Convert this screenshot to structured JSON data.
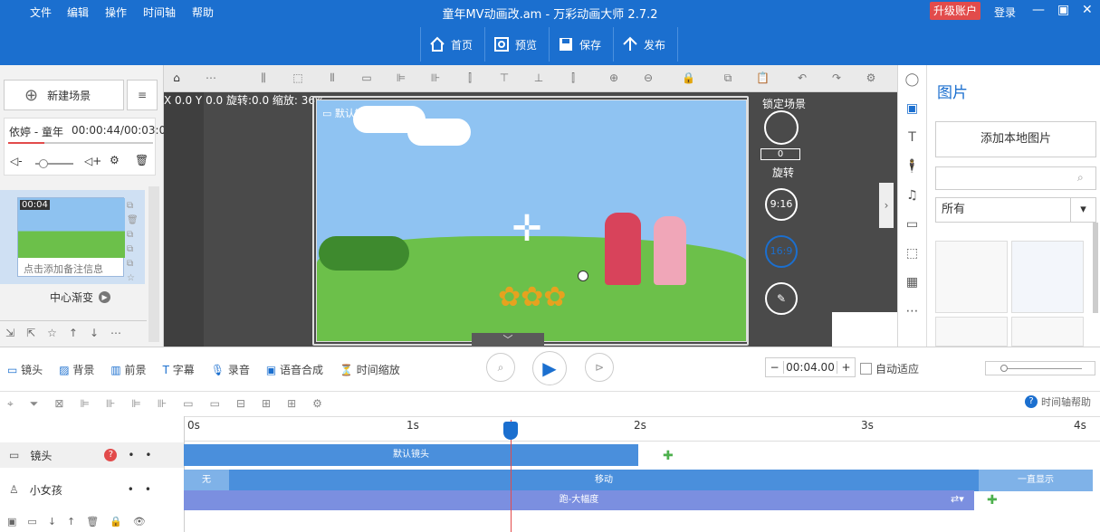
{
  "menu": [
    "文件",
    "编辑",
    "操作",
    "时间轴",
    "帮助"
  ],
  "window_title": "童年MV动画改.am - 万彩动画大师 2.7.2",
  "upgrade_label": "升级账户",
  "login_label": "登录",
  "top_actions": {
    "home": "首页",
    "preview": "预览",
    "save": "保存",
    "publish": "发布"
  },
  "left": {
    "new_scene": "新建场景",
    "audio_name": "依婷 - 童年",
    "audio_time": "00:00:44/00:03:08",
    "scene_number": "7",
    "scene_time": "00:04",
    "scene_note": "点击添加备注信息",
    "transition": "中心渐变"
  },
  "stage": {
    "coords": "X 0.0 Y 0.0 旋转:0.0 缩放: 36%",
    "camera_label": "默认镜头",
    "lock_scene": "锁定场景",
    "rotate_value": "0",
    "rotate_label": "旋转",
    "ratio1": "9:16",
    "ratio2": "16:9"
  },
  "right": {
    "title": "图片",
    "add_local": "添加本地图片",
    "search_placeholder": "",
    "filter": "所有"
  },
  "bottom_tabs": {
    "camera": "镜头",
    "background": "背景",
    "foreground": "前景",
    "subtitle": "字幕",
    "record": "录音",
    "tts": "语音合成",
    "timescale": "时间缩放"
  },
  "duration": "00:04.00",
  "auto_fit": "自动适应",
  "timeline_help": "时间轴帮助",
  "ruler": [
    "0s",
    "1s",
    "2s",
    "3s",
    "4s"
  ],
  "tracks": {
    "camera": {
      "name": "镜头",
      "bar": "默认镜头"
    },
    "girl": {
      "name": "小女孩",
      "enter": "无",
      "move": "移动",
      "exit": "一直显示",
      "action": "跑-大幅度"
    }
  },
  "colors": {
    "blue": "#1b6fcf",
    "track": "#4a8fdc",
    "action": "#7b8fe0",
    "accent": "#e24b4b"
  }
}
